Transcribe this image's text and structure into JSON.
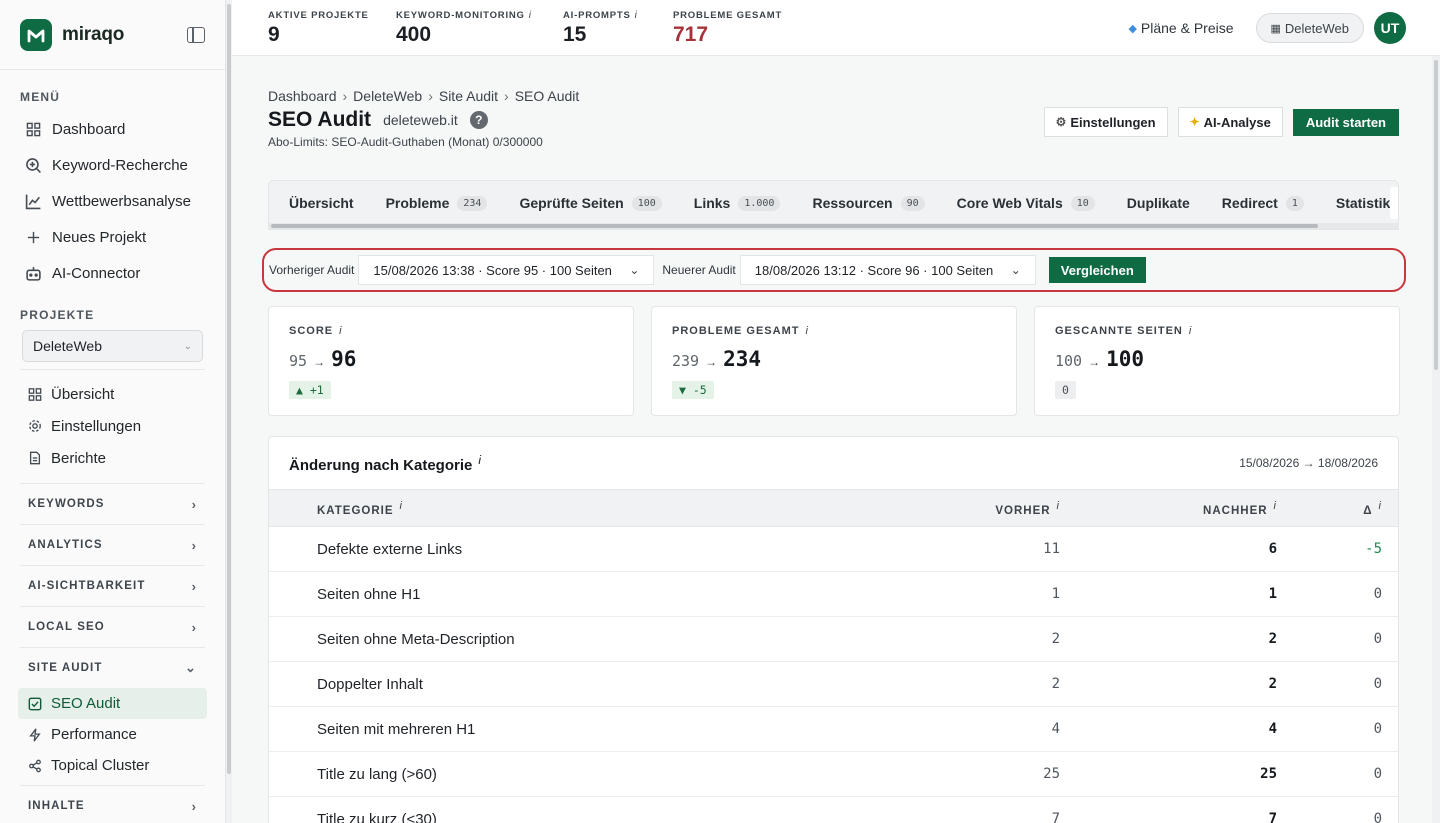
{
  "sidebar": {
    "brand": "miraqo",
    "menu_title": "MENÜ",
    "menu": [
      {
        "label": "Dashboard",
        "icon": "grid-icon"
      },
      {
        "label": "Keyword-Recherche",
        "icon": "search-plus-icon"
      },
      {
        "label": "Wettbewerbsanalyse",
        "icon": "line-chart-icon"
      },
      {
        "label": "Neues Projekt",
        "icon": "plus-icon"
      },
      {
        "label": "AI-Connector",
        "icon": "bot-icon"
      }
    ],
    "projects_title": "PROJEKTE",
    "project_select": "DeleteWeb",
    "project_items": [
      {
        "label": "Übersicht",
        "icon": "grid-icon"
      },
      {
        "label": "Einstellungen",
        "icon": "gear-icon"
      },
      {
        "label": "Berichte",
        "icon": "document-icon"
      }
    ],
    "groups": [
      "KEYWORDS",
      "ANALYTICS",
      "AI-SICHTBARKEIT",
      "LOCAL SEO",
      "SITE AUDIT"
    ],
    "site_audit_items": [
      {
        "label": "SEO Audit",
        "icon": "check-square-icon",
        "active": true
      },
      {
        "label": "Performance",
        "icon": "bolt-icon"
      },
      {
        "label": "Topical Cluster",
        "icon": "share-icon"
      }
    ],
    "last_group": "INHALTE"
  },
  "topbar": {
    "stats": [
      {
        "label": "AKTIVE PROJEKTE",
        "value": "9",
        "info": false
      },
      {
        "label": "KEYWORD-MONITORING",
        "value": "400",
        "info": true
      },
      {
        "label": "AI-PROMPTS",
        "value": "15",
        "info": true
      },
      {
        "label": "PROBLEME GESAMT",
        "value": "717",
        "info": false,
        "color": "#a8323a"
      }
    ],
    "plans_label": "Pläne & Preise",
    "workspace": "DeleteWeb",
    "avatar": "UT"
  },
  "page": {
    "breadcrumb": [
      "Dashboard",
      "DeleteWeb",
      "Site Audit",
      "SEO Audit"
    ],
    "title": "SEO Audit",
    "domain": "deleteweb.it",
    "help": "?",
    "limits": "Abo-Limits: SEO-Audit-Guthaben (Monat) 0/300000",
    "actions": {
      "settings": "Einstellungen",
      "ai_analysis": "AI-Analyse",
      "start": "Audit starten"
    }
  },
  "tabs": [
    {
      "label": "Übersicht",
      "count": ""
    },
    {
      "label": "Probleme",
      "count": "234"
    },
    {
      "label": "Geprüfte Seiten",
      "count": "100"
    },
    {
      "label": "Links",
      "count": "1.000"
    },
    {
      "label": "Ressourcen",
      "count": "90"
    },
    {
      "label": "Core Web Vitals",
      "count": "10"
    },
    {
      "label": "Duplikate",
      "count": ""
    },
    {
      "label": "Redirect",
      "count": "1"
    },
    {
      "label": "Statistiken",
      "count": ""
    }
  ],
  "compare": {
    "prev_label": "Vorheriger Audit",
    "prev_value": "15/08/2026 13:38 · Score 95 · 100 Seiten",
    "next_label": "Neuerer Audit",
    "next_value": "18/08/2026 13:12 · Score 96 · 100 Seiten",
    "button": "Vergleichen"
  },
  "cards": [
    {
      "label": "SCORE",
      "old": "95",
      "new": "96",
      "delta": "▲ +1",
      "tone": "pos"
    },
    {
      "label": "PROBLEME GESAMT",
      "old": "239",
      "new": "234",
      "delta": "▼ -5",
      "tone": "pos"
    },
    {
      "label": "GESCANNTE SEITEN",
      "old": "100",
      "new": "100",
      "delta": "0",
      "tone": "zero"
    }
  ],
  "panel": {
    "title": "Änderung nach Kategorie",
    "range": "15/08/2026 → 18/08/2026",
    "columns": {
      "category": "KATEGORIE",
      "before": "VORHER",
      "after": "NACHHER",
      "delta": "Δ"
    },
    "rows": [
      {
        "category": "Defekte externe Links",
        "before": "11",
        "after": "6",
        "delta": "-5"
      },
      {
        "category": "Seiten ohne H1",
        "before": "1",
        "after": "1",
        "delta": "0"
      },
      {
        "category": "Seiten ohne Meta-Description",
        "before": "2",
        "after": "2",
        "delta": "0"
      },
      {
        "category": "Doppelter Inhalt",
        "before": "2",
        "after": "2",
        "delta": "0"
      },
      {
        "category": "Seiten mit mehreren H1",
        "before": "4",
        "after": "4",
        "delta": "0"
      },
      {
        "category": "Title zu lang (>60)",
        "before": "25",
        "after": "25",
        "delta": "0"
      },
      {
        "category": "Title zu kurz (<30)",
        "before": "7",
        "after": "7",
        "delta": "0"
      }
    ]
  },
  "colors": {
    "brand": "#0f6b44",
    "danger": "#a8323a",
    "highlight": "#c8373d"
  }
}
